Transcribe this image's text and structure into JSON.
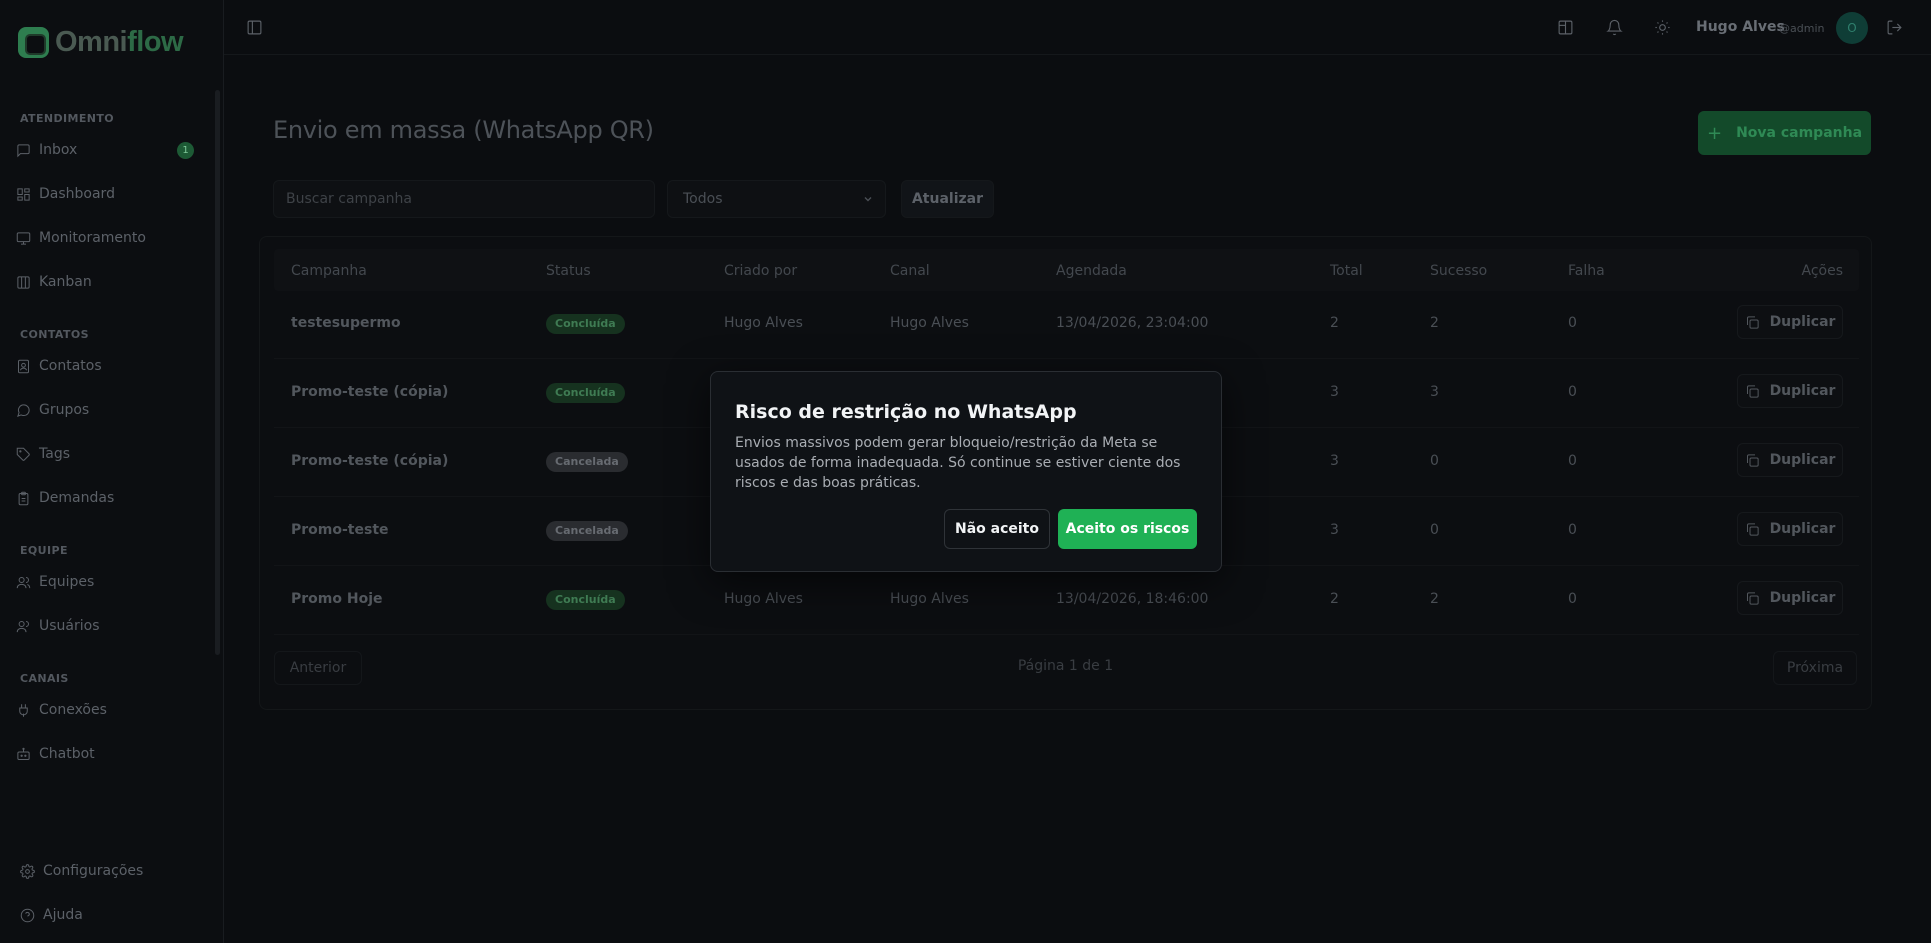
{
  "app": {
    "logo_text_a": "Omni",
    "logo_text_b": "flow"
  },
  "sidebar": {
    "sections": [
      {
        "title": "ATENDIMENTO",
        "items": [
          {
            "label": "Inbox",
            "icon": "message-square-icon",
            "badge": "1"
          },
          {
            "label": "Dashboard",
            "icon": "grid-icon"
          },
          {
            "label": "Monitoramento",
            "icon": "monitor-icon"
          },
          {
            "label": "Kanban",
            "icon": "kanban-icon"
          }
        ]
      },
      {
        "title": "CONTATOS",
        "items": [
          {
            "label": "Contatos",
            "icon": "contact-icon"
          },
          {
            "label": "Grupos",
            "icon": "chat-bubble-icon"
          },
          {
            "label": "Tags",
            "icon": "tag-icon"
          },
          {
            "label": "Demandas",
            "icon": "clipboard-icon"
          }
        ]
      },
      {
        "title": "EQUIPE",
        "items": [
          {
            "label": "Equipes",
            "icon": "users-icon"
          },
          {
            "label": "Usuários",
            "icon": "user-group-icon"
          }
        ]
      },
      {
        "title": "CANAIS",
        "items": [
          {
            "label": "Conexões",
            "icon": "plug-icon"
          },
          {
            "label": "Chatbot",
            "icon": "bot-icon"
          }
        ]
      }
    ],
    "bottom": [
      {
        "label": "Configurações",
        "icon": "gear-icon"
      },
      {
        "label": "Ajuda",
        "icon": "help-circle-icon"
      }
    ]
  },
  "topbar": {
    "user_name": "Hugo Alves",
    "user_handle": "@admin",
    "avatar_initial": "O"
  },
  "main": {
    "title": "Envio em massa (WhatsApp QR)",
    "new_campaign_label": "Nova campanha",
    "search_placeholder": "Buscar campanha",
    "filter_value": "Todos",
    "refresh_label": "Atualizar",
    "columns": [
      "Campanha",
      "Status",
      "Criado por",
      "Canal",
      "Agendada",
      "Total",
      "Sucesso",
      "Falha",
      "Ações"
    ],
    "rows": [
      {
        "campaign": "testesupermo",
        "status": "Concluída",
        "status_type": "done",
        "created_by": "Hugo Alves",
        "channel": "Hugo Alves",
        "scheduled": "13/04/2026, 23:04:00",
        "total": "2",
        "success": "2",
        "failure": "0",
        "action": "Duplicar"
      },
      {
        "campaign": "Promo-teste (cópia)",
        "status": "Concluída",
        "status_type": "done",
        "created_by": "",
        "channel": "",
        "scheduled": "",
        "total": "3",
        "success": "3",
        "failure": "0",
        "action": "Duplicar"
      },
      {
        "campaign": "Promo-teste (cópia)",
        "status": "Cancelada",
        "status_type": "cancel",
        "created_by": "",
        "channel": "",
        "scheduled": "",
        "total": "3",
        "success": "0",
        "failure": "0",
        "action": "Duplicar"
      },
      {
        "campaign": "Promo-teste",
        "status": "Cancelada",
        "status_type": "cancel",
        "created_by": "",
        "channel": "",
        "scheduled": "",
        "total": "3",
        "success": "0",
        "failure": "0",
        "action": "Duplicar"
      },
      {
        "campaign": "Promo Hoje",
        "status": "Concluída",
        "status_type": "done",
        "created_by": "Hugo Alves",
        "channel": "Hugo Alves",
        "scheduled": "13/04/2026, 18:46:00",
        "total": "2",
        "success": "2",
        "failure": "0",
        "action": "Duplicar"
      }
    ],
    "pagination": {
      "prev_label": "Anterior",
      "page_info": "Página 1 de 1",
      "next_label": "Próxima"
    }
  },
  "modal": {
    "title": "Risco de restrição no WhatsApp",
    "body": "Envios massivos podem gerar bloqueio/restrição da Meta se usados de forma inadequada. Só continue se estiver ciente dos riscos e das boas práticas.",
    "decline_label": "Não aceito",
    "accept_label": "Aceito os riscos"
  },
  "colors": {
    "accent_green": "#1fb155",
    "background": "#0b0d10"
  }
}
